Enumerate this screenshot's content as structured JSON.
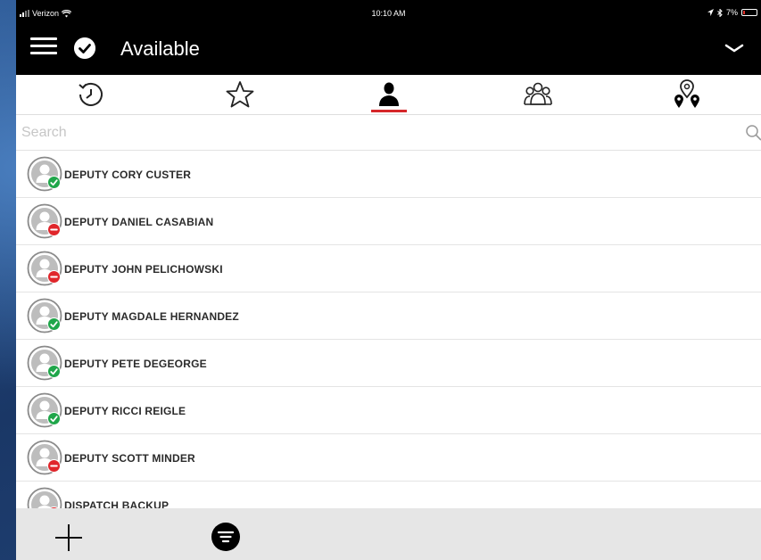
{
  "status_bar": {
    "carrier": "Verizon",
    "time": "10:10 AM",
    "battery": "7%"
  },
  "header": {
    "title": "Available",
    "menu_icon": "hamburger-icon",
    "status_icon": "check-circle-icon",
    "dropdown_icon": "chevron-down-icon"
  },
  "tabs": [
    {
      "icon": "recent-history-icon",
      "active": false
    },
    {
      "icon": "star-icon",
      "active": false
    },
    {
      "icon": "person-icon",
      "active": true
    },
    {
      "icon": "group-icon",
      "active": false
    },
    {
      "icon": "location-pins-icon",
      "active": false
    }
  ],
  "search": {
    "placeholder": "Search",
    "value": ""
  },
  "contacts": [
    {
      "name": "DEPUTY CORY CUSTER",
      "status": "available"
    },
    {
      "name": "DEPUTY DANIEL CASABIAN",
      "status": "busy"
    },
    {
      "name": "DEPUTY JOHN PELICHOWSKI",
      "status": "busy"
    },
    {
      "name": "DEPUTY MAGDALE HERNANDEZ",
      "status": "available"
    },
    {
      "name": "DEPUTY PETE DEGEORGE",
      "status": "available"
    },
    {
      "name": "DEPUTY RICCI REIGLE",
      "status": "available"
    },
    {
      "name": "DEPUTY SCOTT MINDER",
      "status": "busy"
    },
    {
      "name": "DISPATCH BACKUP",
      "status": "busy"
    }
  ],
  "colors": {
    "available": "#1fa64a",
    "busy": "#e0262b",
    "accent": "#d6272a"
  },
  "bottom_bar": {
    "add_icon": "plus-icon",
    "filter_icon": "filter-icon"
  }
}
